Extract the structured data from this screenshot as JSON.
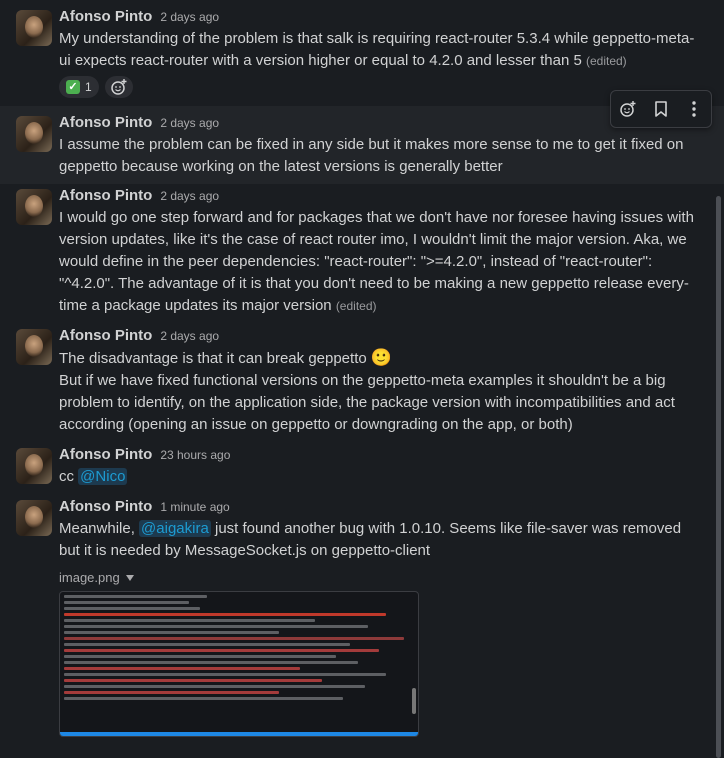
{
  "author": "Afonso Pinto",
  "messages": [
    {
      "time": "2 days ago",
      "text": "My understanding of the problem is that salk is requiring react-router 5.3.4 while geppetto-meta-ui expects react-router with a version higher or equal to 4.2.0 and lesser than 5",
      "edited": "(edited)"
    },
    {
      "time": "2 days ago",
      "text": "I assume the problem can be fixed in any side but it makes more sense to me to get it fixed on geppetto because working on the latest versions is generally better"
    },
    {
      "time": "2 days ago",
      "text": "I would go one step forward and for packages that we don't have nor foresee having issues with version updates, like it's the case of react router imo, I wouldn't limit the major version. Aka, we would define in the peer dependencies: \"react-router\": \">=4.2.0\", instead of \"react-router\": \"^4.2.0\". The advantage of it is that you don't need to be making a new geppetto release  every-time a package updates its major version",
      "edited": "(edited)"
    },
    {
      "time": "2 days ago",
      "text1": "The disadvantage is that it can break geppetto",
      "emoji": "🙂",
      "text2": "But if we have fixed functional versions on the geppetto-meta examples it shouldn't be a big problem to identify, on the application side, the package version with incompatibilities and act according (opening an issue on geppetto or downgrading on the app, or both)"
    },
    {
      "time": "23 hours ago",
      "prefix": "cc",
      "mention": "@Nico"
    },
    {
      "time": "1 minute ago",
      "before": "Meanwhile, ",
      "mention": "@aigakira",
      "after": " just found another bug with 1.0.10. Seems like file-saver was removed but it is needed by MessageSocket.js on geppetto-client"
    }
  ],
  "reaction": {
    "emoji": "✅",
    "count": "1"
  },
  "attachment": {
    "filename": "image.png"
  },
  "colors": {
    "background": "#1a1d21",
    "mention": "#1d9bd1",
    "hover": "#222529"
  }
}
